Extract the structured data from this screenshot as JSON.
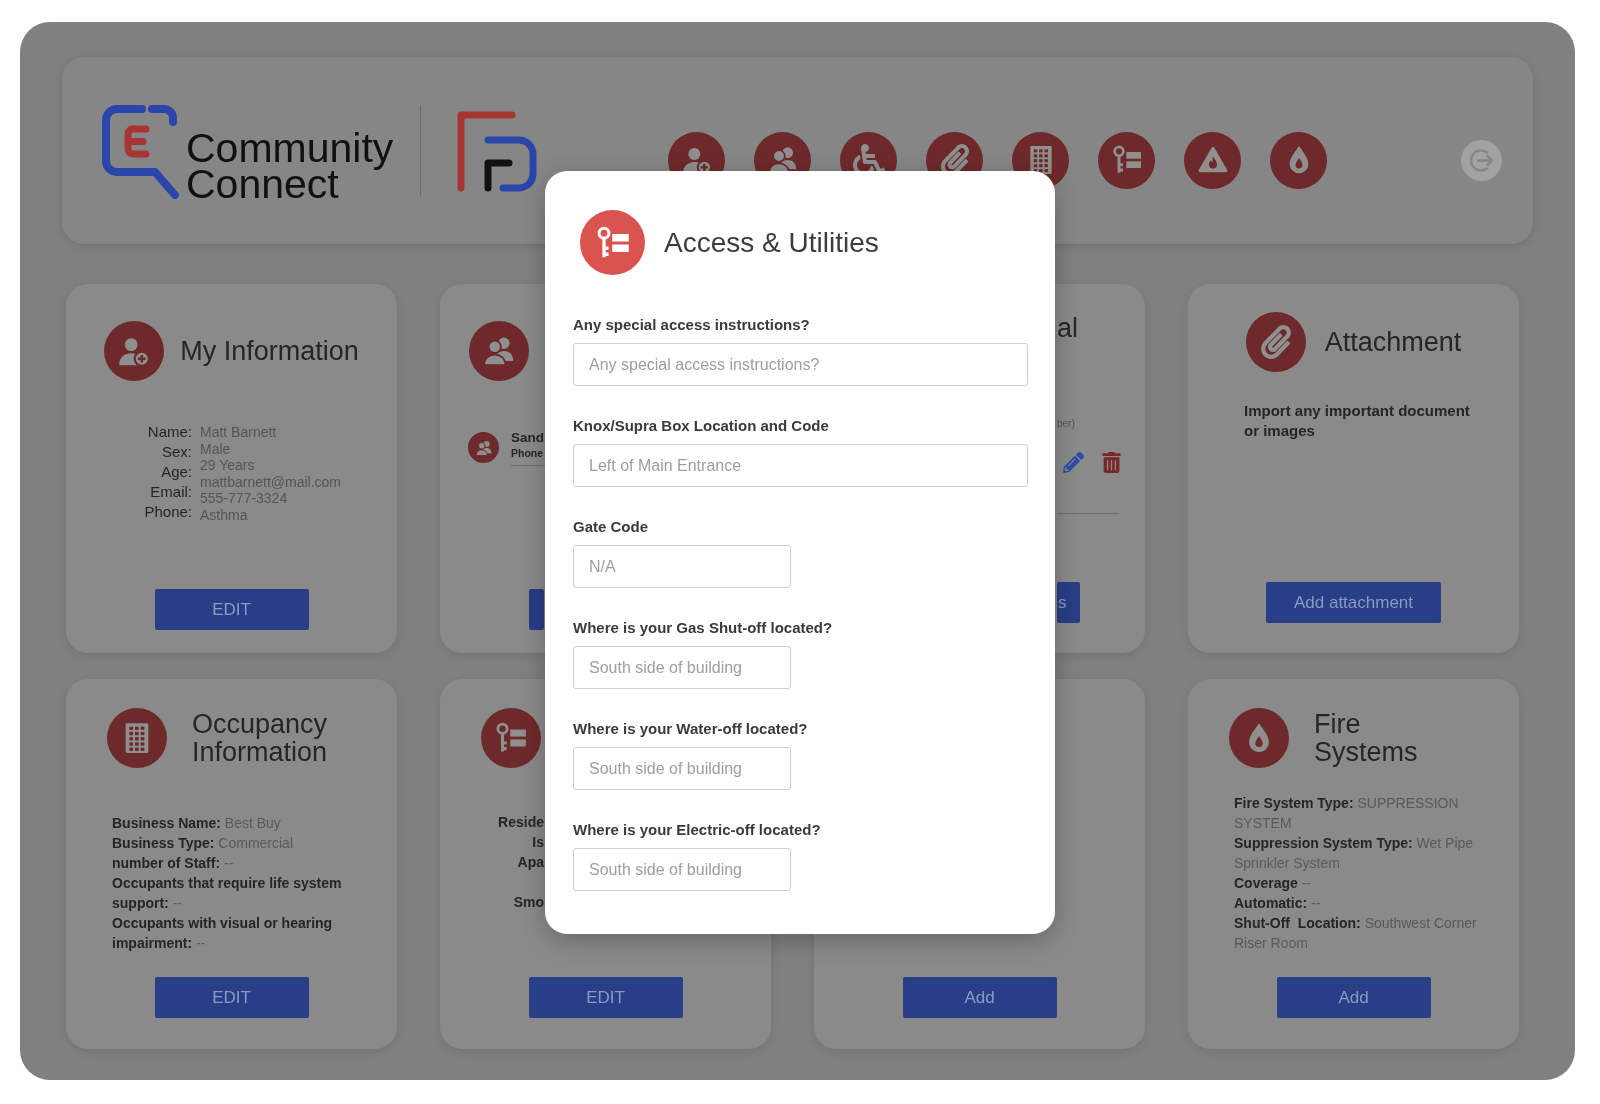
{
  "header": {
    "logo_text": "Community Connect"
  },
  "cards": [
    {
      "kind": "profile",
      "title": "My Information",
      "labels": [
        "Name:",
        "Sex:",
        "Age:",
        "Email:",
        "Phone:"
      ],
      "values": [
        "Matt Barnett",
        "Male",
        "29 Years",
        "mattbarnett@mail.com",
        "555-777-3324",
        "Asthma"
      ],
      "button": "EDIT"
    },
    {
      "kind": "contacts",
      "contacts": [
        {
          "name": "Sand",
          "detail": "Phone"
        }
      ],
      "button_visible": true
    },
    {
      "kind": "contact_actions",
      "title": "al",
      "note": "ber)",
      "button": "s"
    },
    {
      "kind": "attachment",
      "title": "Attachment",
      "description": "Import any important document or images",
      "button": "Add attachment"
    },
    {
      "kind": "details",
      "title": "Occupancy Information",
      "lines": [
        "**Business Name:** Best Buy",
        "**Business Type:** Commercial",
        "**number of Staff:** --",
        "**Occupants that require life system support:** --",
        "**Occupants with visual or hearing impairment:** --"
      ],
      "button": "EDIT"
    },
    {
      "kind": "fragments",
      "groups": [
        [
          "Reside",
          "Is",
          "Apa"
        ],
        [
          "Smo"
        ]
      ],
      "button": "EDIT"
    },
    {
      "kind": "covered",
      "button": "Add"
    },
    {
      "kind": "details",
      "title": "Fire Systems",
      "lines": [
        "**Fire System Type:** SUPPRESSION SYSTEM",
        "**Suppression System Type:** Wet Pipe Sprinkler System",
        "**Coverage** --",
        "**Automatic:** --",
        "**Shut-Off  Location:** Southwest Corner Riser Room"
      ],
      "button": "Add"
    }
  ],
  "modal": {
    "title": "Access & Utilities",
    "fields": [
      {
        "label": "Any special access instructions?",
        "placeholder": "Any special access instructions?"
      },
      {
        "label": "Knox/Supra Box Location and Code",
        "placeholder": "Left of Main Entrance"
      },
      {
        "label": "Gate Code",
        "placeholder": "N/A"
      },
      {
        "label": "Where is your Gas Shut-off located?",
        "placeholder": "South side of building"
      },
      {
        "label": "Where is your Water-off located?",
        "placeholder": "South side of building"
      },
      {
        "label": "Where is your Electric-off located?",
        "placeholder": "South side of building"
      }
    ]
  }
}
